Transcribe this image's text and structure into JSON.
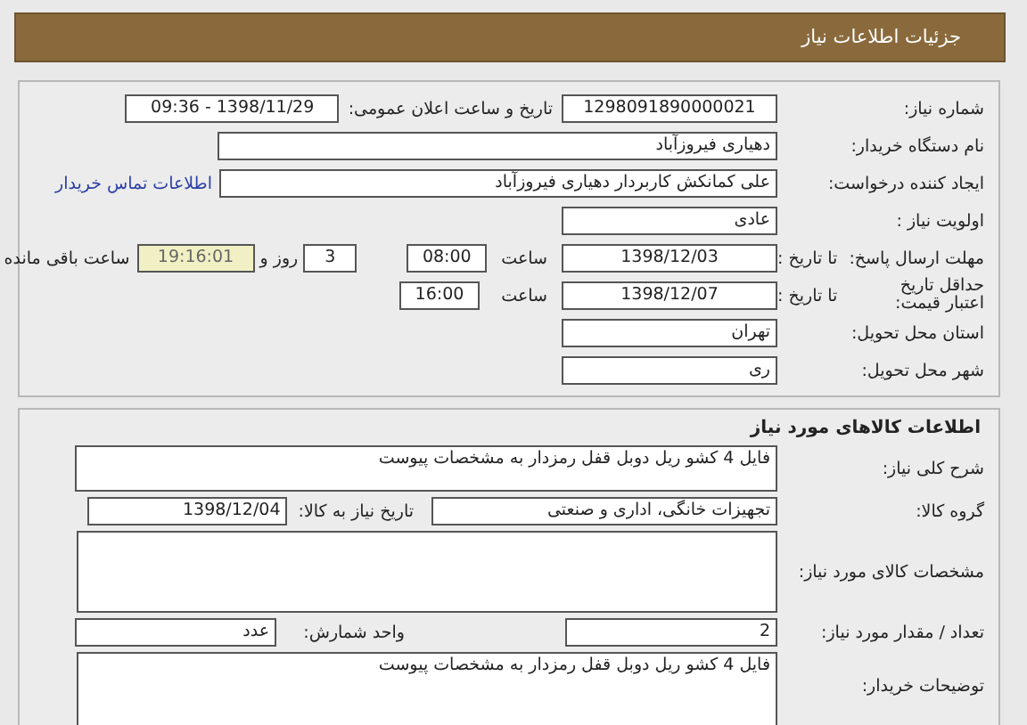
{
  "header": {
    "title": "جزئیات اطلاعات نیاز"
  },
  "details": {
    "need_number": {
      "label": "شماره نیاز:",
      "value": "1298091890000021"
    },
    "announce": {
      "label": "تاریخ و ساعت اعلان عمومی:",
      "value": "1398/11/29 - 09:36"
    },
    "buyer": {
      "label": "نام دستگاه خریدار:",
      "value": "دهیاری فیروزآباد"
    },
    "creator": {
      "label": "ایجاد کننده درخواست:",
      "value": "علی کمانکش کاربردار دهیاری فیروزآباد",
      "link": "اطلاعات تماس خریدار"
    },
    "priority": {
      "label": "اولویت نیاز :",
      "value": "عادی"
    },
    "deadline": {
      "label": "مهلت ارسال پاسخ:",
      "to_date_label": "تا تاریخ :",
      "date": "1398/12/03",
      "time_label": "ساعت",
      "time": "08:00",
      "days": "3",
      "days_label": "روز و",
      "remaining": "19:16:01",
      "remaining_label": "ساعت باقی مانده"
    },
    "validity": {
      "label": "حداقل تاریخ اعتبار قیمت:",
      "to_date_label": "تا تاریخ :",
      "date": "1398/12/07",
      "time_label": "ساعت",
      "time": "16:00"
    },
    "province": {
      "label": "استان محل تحویل:",
      "value": "تهران"
    },
    "city": {
      "label": "شهر محل تحویل:",
      "value": "ری"
    }
  },
  "goods": {
    "title": "اطلاعات کالاهای مورد نیاز",
    "summary": {
      "label": "شرح کلی نیاز:",
      "value": "فایل 4 کشو ریل دوبل قفل رمزدار به مشخصات پیوست"
    },
    "group": {
      "label": "گروه کالا:",
      "value": "تجهیزات خانگی، اداری و صنعتی"
    },
    "need_date": {
      "label": "تاریخ نیاز به کالا:",
      "value": "1398/12/04"
    },
    "specs": {
      "label": "مشخصات کالای مورد نیاز:"
    },
    "quantity": {
      "label": "تعداد / مقدار مورد نیاز:",
      "value": "2"
    },
    "unit": {
      "label": "واحد شمارش:",
      "value": "عدد"
    },
    "notes": {
      "label": "توضیحات خریدار:",
      "value": "فایل 4 کشو ریل دوبل قفل رمزدار به مشخصات پیوست"
    }
  }
}
